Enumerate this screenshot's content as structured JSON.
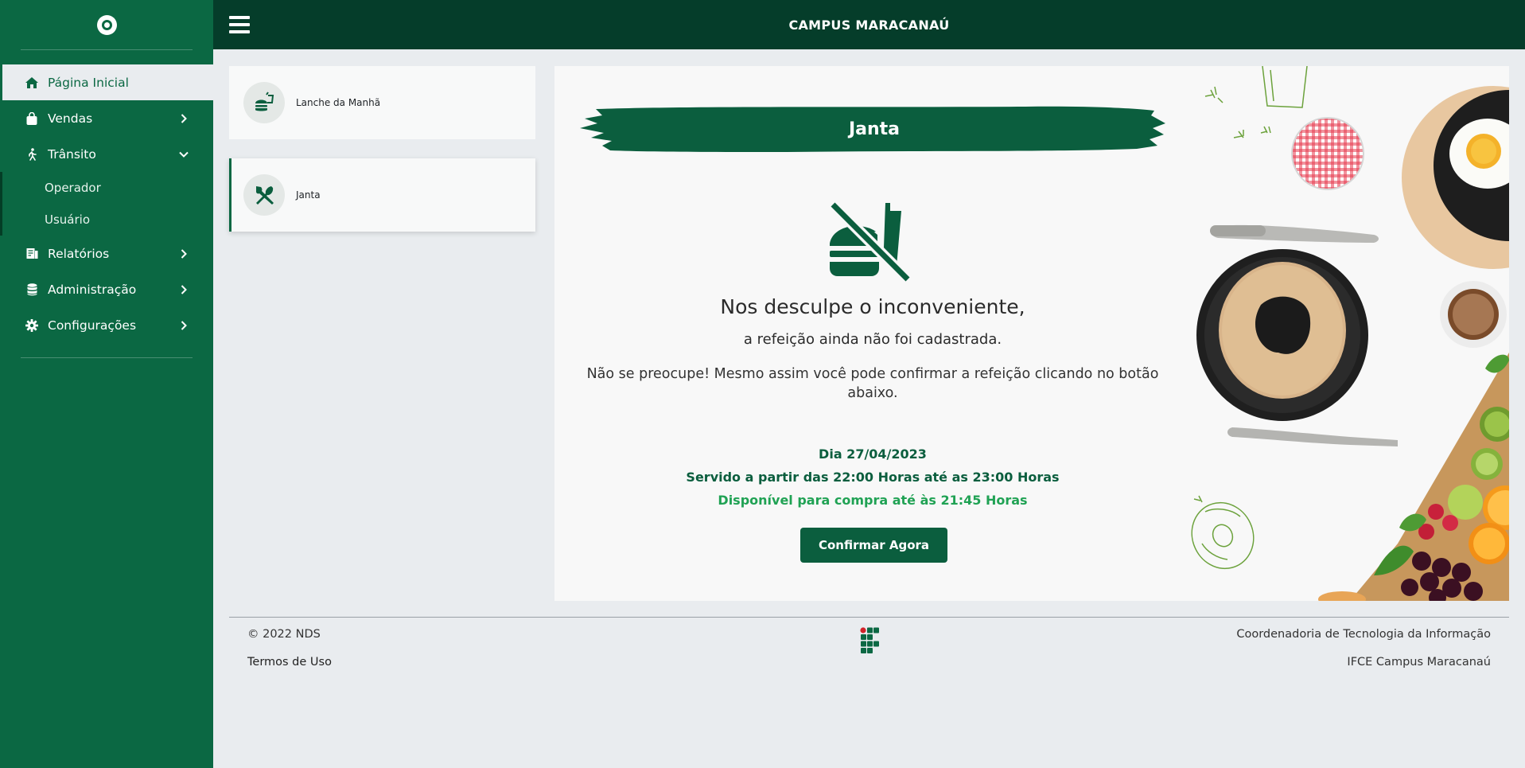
{
  "topbar": {
    "title": "CAMPUS MARACANAÚ"
  },
  "sidebar": {
    "items": [
      {
        "label": "Página Inicial",
        "icon": "home-icon"
      },
      {
        "label": "Vendas",
        "icon": "shopping-bag-icon"
      },
      {
        "label": "Trânsito",
        "icon": "walking-icon"
      },
      {
        "label": "Relatórios",
        "icon": "report-icon"
      },
      {
        "label": "Administração",
        "icon": "database-icon"
      },
      {
        "label": "Configurações",
        "icon": "gear-icon"
      }
    ],
    "transit_subitems": [
      {
        "label": "Operador"
      },
      {
        "label": "Usuário"
      }
    ]
  },
  "meals": [
    {
      "label": "Lanche da Manhã",
      "icon": "burger-drink-icon"
    },
    {
      "label": "Janta",
      "icon": "utensils-icon"
    }
  ],
  "panel": {
    "title": "Janta",
    "heading": "Nos desculpe o inconveniente,",
    "subheading": "a refeição ainda não foi cadastrada.",
    "paragraph": "Não se preocupe! Mesmo assim você pode confirmar a refeição clicando no botão abaixo.",
    "date": "Dia 27/04/2023",
    "served": "Servido a partir das 22:00 Horas até as 23:00 Horas",
    "available": "Disponível para compra até às 21:45 Horas",
    "confirm_label": "Confirmar Agora"
  },
  "footer": {
    "copyright": "© 2022 NDS",
    "terms": "Termos de Uso",
    "org_line1": "Coordenadoria de Tecnologia da Informação",
    "org_line2": "IFCE Campus Maracanaú"
  },
  "colors": {
    "sidebar": "#0b6843",
    "topbar": "#053d2a",
    "accent": "#0b5e3e",
    "available": "#20a254",
    "background": "#e9ecef"
  }
}
